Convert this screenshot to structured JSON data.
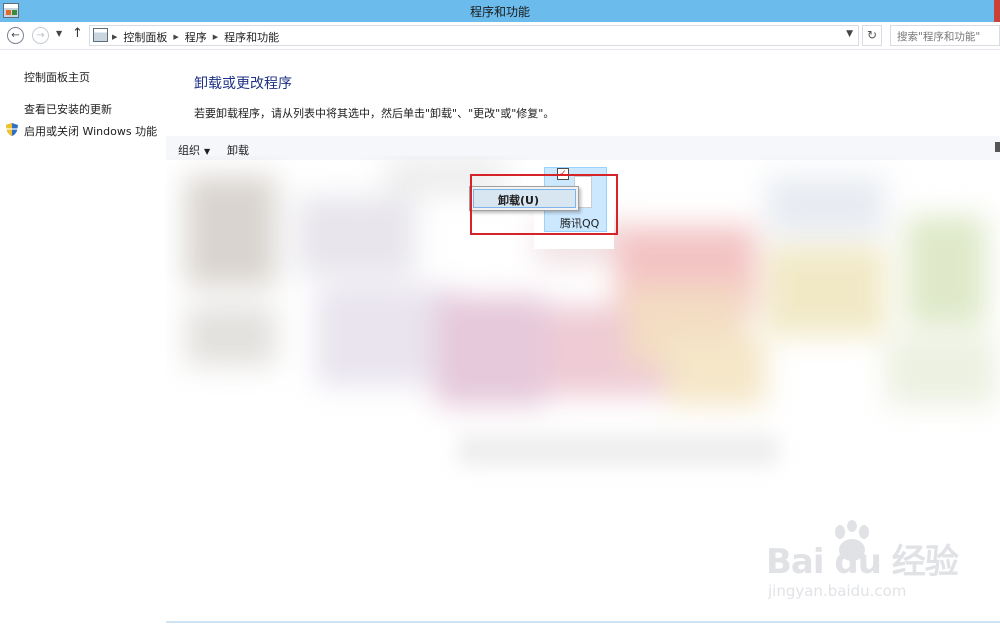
{
  "window": {
    "title": "程序和功能"
  },
  "addressbar": {
    "breadcrumbs": [
      "控制面板",
      "程序",
      "程序和功能"
    ],
    "search_placeholder": "搜索\"程序和功能\""
  },
  "sidebar": {
    "items": [
      {
        "label": "控制面板主页"
      },
      {
        "label": "查看已安装的更新"
      },
      {
        "label": "启用或关闭 Windows 功能"
      }
    ]
  },
  "main": {
    "title": "卸载或更改程序",
    "description": "若要卸载程序，请从列表中将其选中，然后单击\"卸载\"、\"更改\"或\"修复\"。"
  },
  "toolbar": {
    "organize_label": "组织",
    "uninstall_label": "卸载"
  },
  "selected_item": {
    "label": "腾讯QQ",
    "checked": true
  },
  "context_menu": {
    "items": [
      {
        "label": "卸载(U)"
      }
    ]
  },
  "watermark": {
    "brand": "Bai du 经验",
    "url": "jingyan.baidu.com"
  },
  "colors": {
    "titlebar": "#6bbcec",
    "heading": "#1e3287",
    "highlight": "#d6232a",
    "selection": "#cce8ff"
  }
}
